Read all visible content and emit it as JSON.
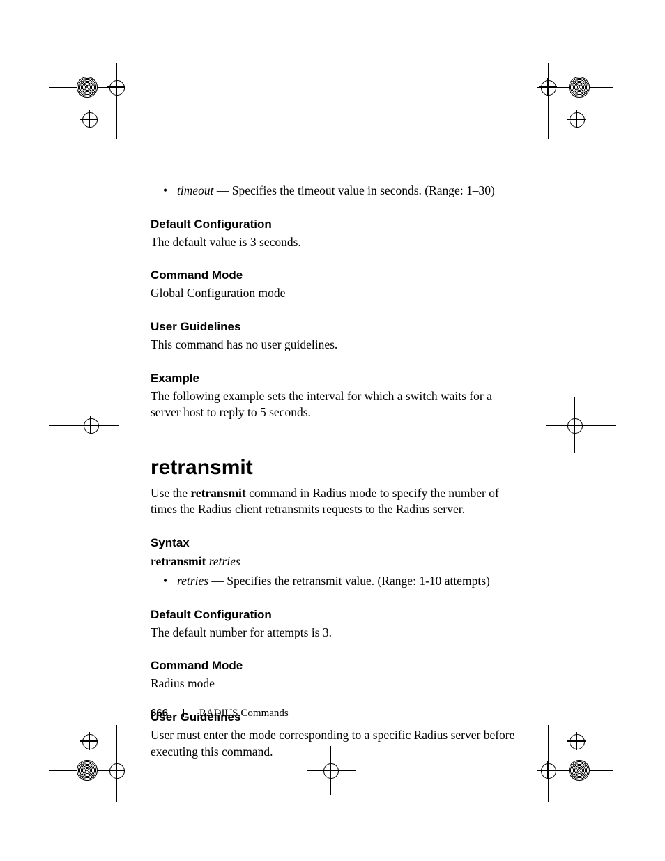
{
  "bullet_timeout": {
    "term": "timeout",
    "text": " — Specifies the timeout value in seconds. (Range: 1–30)"
  },
  "sec1_default_h": "Default Configuration",
  "sec1_default_b": "The default value is 3 seconds.",
  "sec1_mode_h": "Command Mode",
  "sec1_mode_b": "Global Configuration mode",
  "sec1_guide_h": "User Guidelines",
  "sec1_guide_b": "This command has no user guidelines.",
  "sec1_ex_h": "Example",
  "sec1_ex_b": "The following example sets the interval for which a switch waits for a server host to reply to 5 seconds.",
  "cmd_title": "retransmit",
  "cmd_intro_pre": "Use the ",
  "cmd_intro_bold": "retransmit",
  "cmd_intro_post": " command in Radius mode to specify the number of times the Radius client retransmits requests to the Radius server.",
  "syntax_h": "Syntax",
  "syntax_cmd": "retransmit",
  "syntax_arg": "retries",
  "bullet_retries": {
    "term": "retries",
    "text": " — Specifies the retransmit value. (Range: 1-10 attempts)"
  },
  "sec2_default_h": "Default Configuration",
  "sec2_default_b": "The default number for attempts is 3.",
  "sec2_mode_h": "Command Mode",
  "sec2_mode_b": " Radius mode",
  "sec2_guide_h": "User Guidelines",
  "sec2_guide_b": "User must enter the mode corresponding to a specific Radius server before executing this command.",
  "footer_page": "666",
  "footer_section": "RADIUS Commands"
}
